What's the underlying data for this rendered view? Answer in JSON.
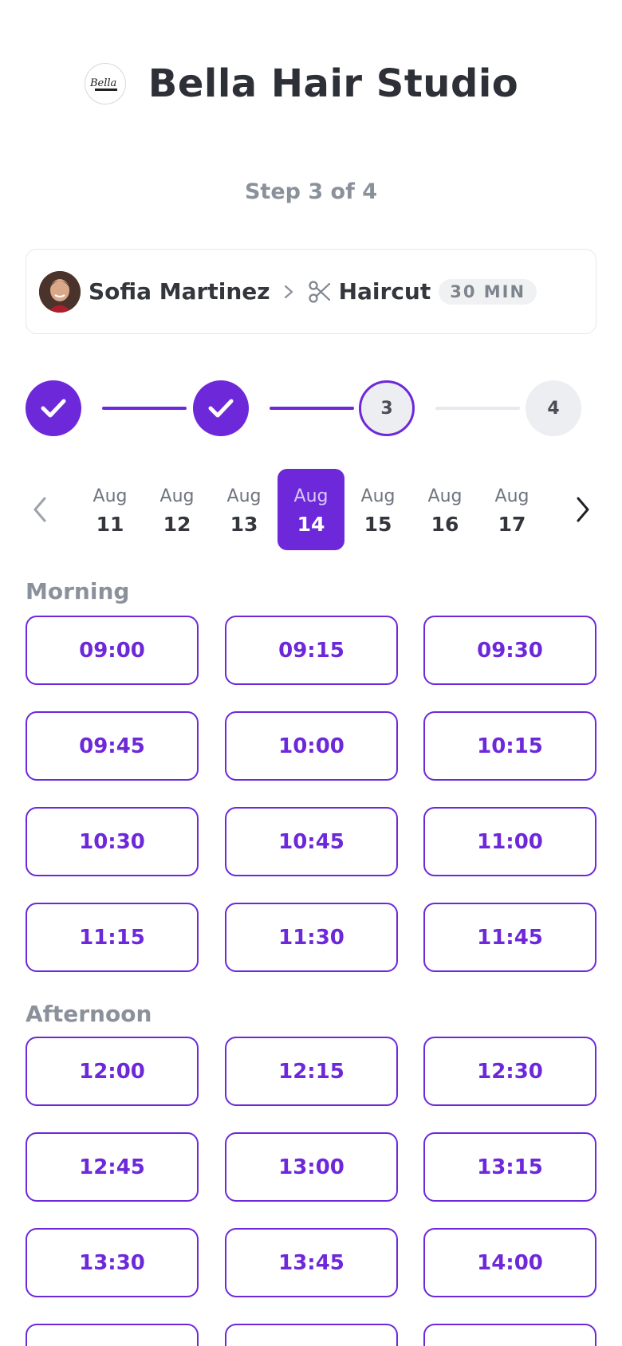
{
  "header": {
    "studio_name": "Bella Hair Studio",
    "logo_text": "Bella"
  },
  "step_label": "Step 3 of 4",
  "summary": {
    "stylist_name": "Sofia Martinez",
    "service_name": "Haircut",
    "duration": "30 MIN"
  },
  "stepper": {
    "steps": [
      {
        "label": "",
        "state": "done"
      },
      {
        "label": "",
        "state": "done"
      },
      {
        "label": "3",
        "state": "current"
      },
      {
        "label": "4",
        "state": "todo"
      }
    ]
  },
  "dates": [
    {
      "month": "Aug",
      "day": "11",
      "selected": false
    },
    {
      "month": "Aug",
      "day": "12",
      "selected": false
    },
    {
      "month": "Aug",
      "day": "13",
      "selected": false
    },
    {
      "month": "Aug",
      "day": "14",
      "selected": true
    },
    {
      "month": "Aug",
      "day": "15",
      "selected": false
    },
    {
      "month": "Aug",
      "day": "16",
      "selected": false
    },
    {
      "month": "Aug",
      "day": "17",
      "selected": false
    }
  ],
  "morning": {
    "title": "Morning",
    "slots": [
      "09:00",
      "09:15",
      "09:30",
      "09:45",
      "10:00",
      "10:15",
      "10:30",
      "10:45",
      "11:00",
      "11:15",
      "11:30",
      "11:45"
    ]
  },
  "afternoon": {
    "title": "Afternoon",
    "slots": [
      "12:00",
      "12:15",
      "12:30",
      "12:45",
      "13:00",
      "13:15",
      "13:30",
      "13:45",
      "14:00",
      "",
      "",
      ""
    ]
  },
  "colors": {
    "accent": "#6d28d9",
    "muted": "#8b919b",
    "text": "#2e3038"
  },
  "icons": [
    "logo",
    "chevron-right-icon",
    "scissors-icon",
    "check-icon",
    "chevron-left-icon",
    "chevron-right-icon"
  ]
}
